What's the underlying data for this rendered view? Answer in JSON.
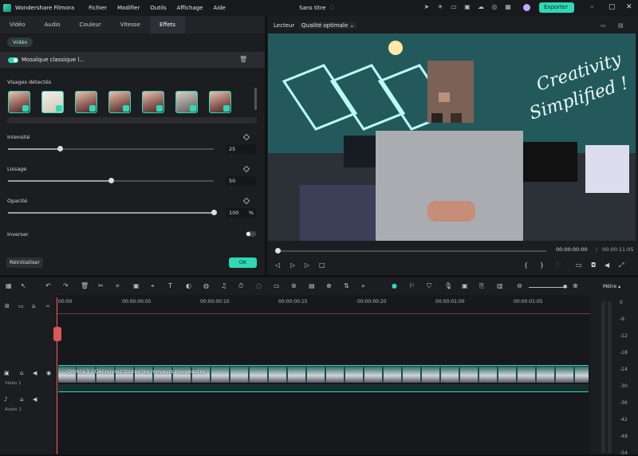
{
  "app": {
    "name": "Wondershare Filmora",
    "doc_title": "Sans titre",
    "export_label": "Exporter",
    "menu": [
      "Fichier",
      "Modifier",
      "Outils",
      "Affichage",
      "Aide"
    ]
  },
  "left_panel": {
    "tabs": [
      "Vidéo",
      "Audio",
      "Couleur",
      "Vitesse",
      "Effets"
    ],
    "subtab": "Vidéo",
    "effect_name": "Mosaïque classique l...",
    "faces_label": "Visages détectés",
    "sliders": [
      {
        "label": "Intensité",
        "value": "25",
        "fraction": 0.25
      },
      {
        "label": "Lissage",
        "value": "50",
        "fraction": 0.5
      },
      {
        "label": "Opacité",
        "value": "100",
        "unit": "%",
        "fraction": 1.0
      }
    ],
    "invert_label": "Inverser",
    "reset_label": "Réinitialiser",
    "ok_label": "OK"
  },
  "player": {
    "label": "Lecteur",
    "quality": "Qualité optimale",
    "current_time": "00:00:00:00",
    "total_time": "00:00:11:05",
    "neon_text_1": "Creativity",
    "neon_text_2": "Simplified !"
  },
  "timeline": {
    "ruler": [
      "00:00",
      "00:00:00:05",
      "00:00:00:10",
      "00:00:00:15",
      "00:00:00:20",
      "00:00:01:00",
      "00:00:01:05"
    ],
    "clip_title": "Ombra 1 / Découvrez toutes les moyeurs nouveautés",
    "video_track": "Vidéo 1",
    "audio_track": "Audio 1"
  },
  "meter": {
    "title": "Mètre",
    "scale": [
      "0",
      "-6",
      "-12",
      "-18",
      "-24",
      "-30",
      "-36",
      "-42",
      "-48",
      "-54"
    ]
  },
  "colors": {
    "accent": "#2fd9b4",
    "playhead": "#ff5a5a"
  }
}
